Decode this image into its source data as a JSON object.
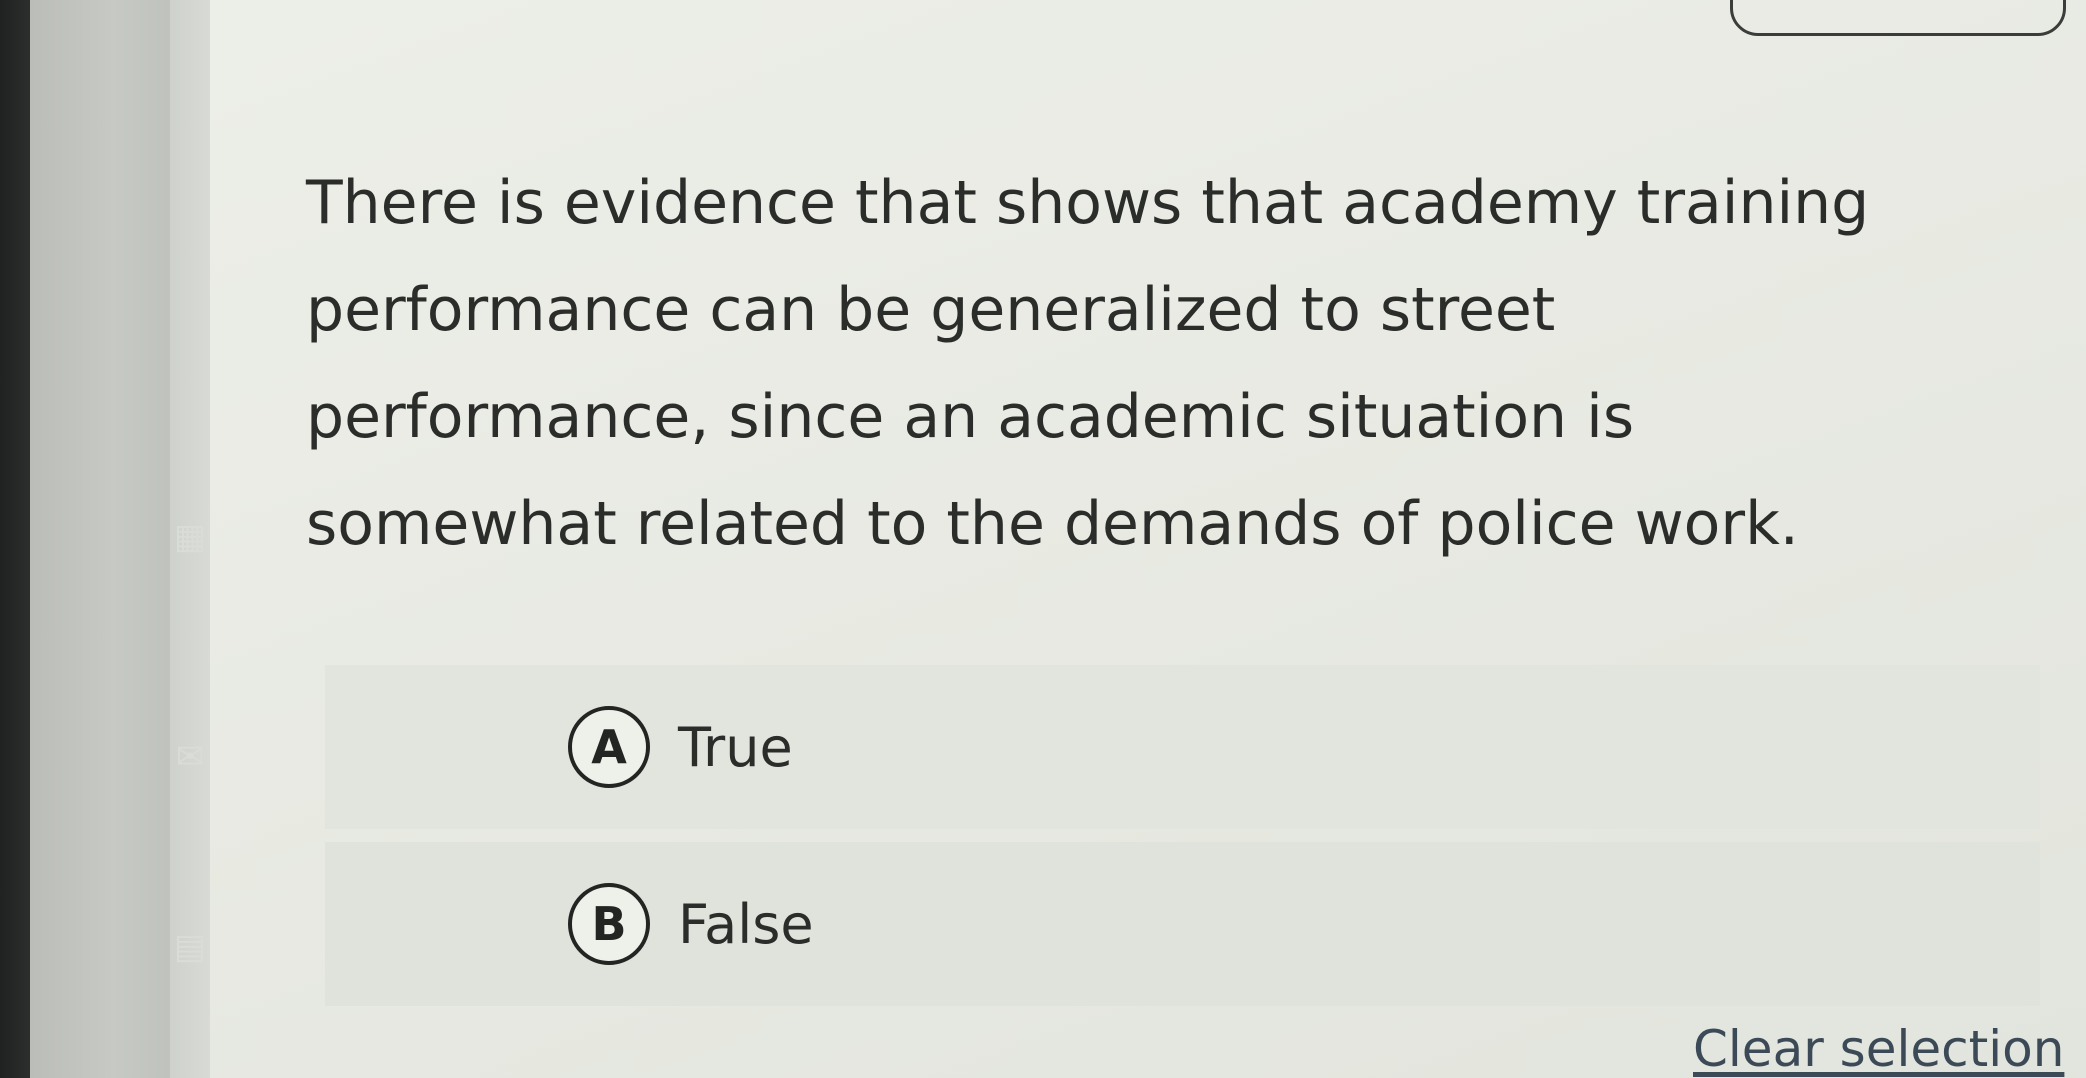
{
  "question": {
    "text": "There is evidence that shows that academy training performance can be generalized to street performance, since an academic situation is somewhat related to the demands of police work."
  },
  "options": [
    {
      "letter": "A",
      "label": "True"
    },
    {
      "letter": "B",
      "label": "False"
    }
  ],
  "actions": {
    "clear_selection": "Clear selection"
  },
  "sidebar": {
    "icons": [
      "grid-icon",
      "mail-icon",
      "document-icon"
    ]
  },
  "colors": {
    "background": "#e6e8e1",
    "text": "#2b2d2b",
    "link": "#3c4a57"
  }
}
